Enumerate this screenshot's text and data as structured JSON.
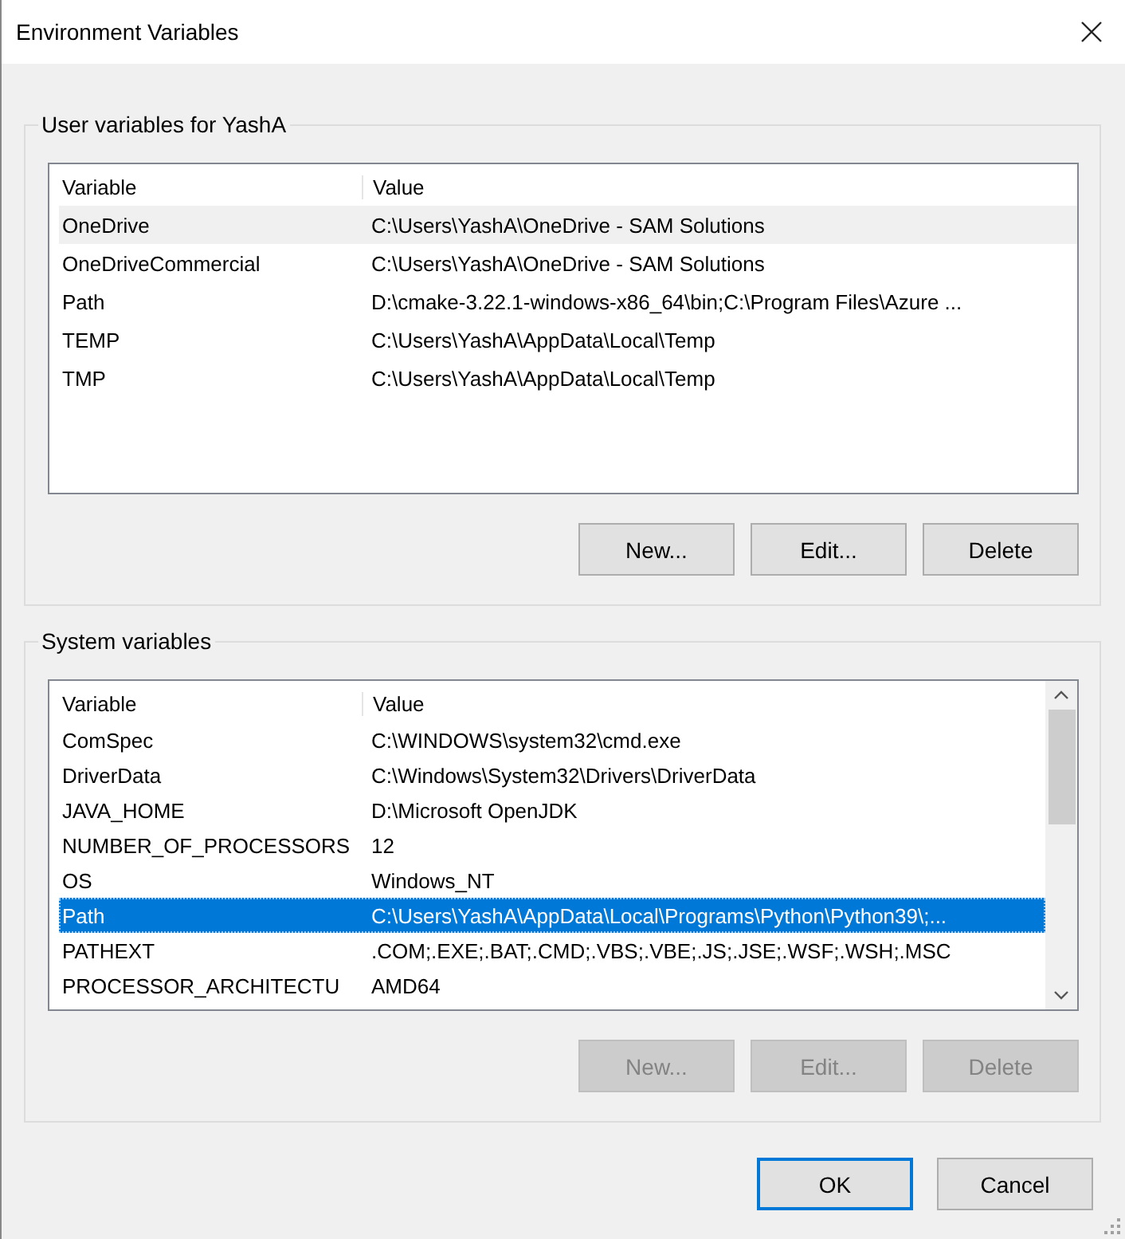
{
  "window": {
    "title": "Environment Variables"
  },
  "groups": [
    {
      "legend": "User variables for YashA",
      "list": {
        "focused": false,
        "scrollbar": false,
        "columns": [
          "Variable",
          "Value"
        ],
        "rows": [
          {
            "variable": "OneDrive",
            "value": "C:\\Users\\YashA\\OneDrive - SAM Solutions",
            "selected": true
          },
          {
            "variable": "OneDriveCommercial",
            "value": "C:\\Users\\YashA\\OneDrive - SAM Solutions",
            "selected": false
          },
          {
            "variable": "Path",
            "value": "D:\\cmake-3.22.1-windows-x86_64\\bin;C:\\Program Files\\Azure ...",
            "selected": false
          },
          {
            "variable": "TEMP",
            "value": "C:\\Users\\YashA\\AppData\\Local\\Temp",
            "selected": false
          },
          {
            "variable": "TMP",
            "value": "C:\\Users\\YashA\\AppData\\Local\\Temp",
            "selected": false
          }
        ]
      },
      "buttons": [
        {
          "label": "New...",
          "disabled": false
        },
        {
          "label": "Edit...",
          "disabled": false
        },
        {
          "label": "Delete",
          "disabled": false
        }
      ]
    },
    {
      "legend": "System variables",
      "list": {
        "focused": true,
        "scrollbar": true,
        "columns": [
          "Variable",
          "Value"
        ],
        "rows": [
          {
            "variable": "ComSpec",
            "value": "C:\\WINDOWS\\system32\\cmd.exe",
            "selected": false
          },
          {
            "variable": "DriverData",
            "value": "C:\\Windows\\System32\\Drivers\\DriverData",
            "selected": false
          },
          {
            "variable": "JAVA_HOME",
            "value": "D:\\Microsoft OpenJDK",
            "selected": false
          },
          {
            "variable": "NUMBER_OF_PROCESSORS",
            "value": "12",
            "selected": false
          },
          {
            "variable": "OS",
            "value": "Windows_NT",
            "selected": false
          },
          {
            "variable": "Path",
            "value": "C:\\Users\\YashA\\AppData\\Local\\Programs\\Python\\Python39\\;...",
            "selected": true
          },
          {
            "variable": "PATHEXT",
            "value": ".COM;.EXE;.BAT;.CMD;.VBS;.VBE;.JS;.JSE;.WSF;.WSH;.MSC",
            "selected": false
          },
          {
            "variable": "PROCESSOR_ARCHITECTU",
            "value": "AMD64",
            "selected": false
          }
        ]
      },
      "buttons": [
        {
          "label": "New...",
          "disabled": true
        },
        {
          "label": "Edit...",
          "disabled": true
        },
        {
          "label": "Delete",
          "disabled": true
        }
      ]
    }
  ],
  "footer": [
    {
      "label": "OK",
      "default": true
    },
    {
      "label": "Cancel",
      "default": false
    }
  ]
}
